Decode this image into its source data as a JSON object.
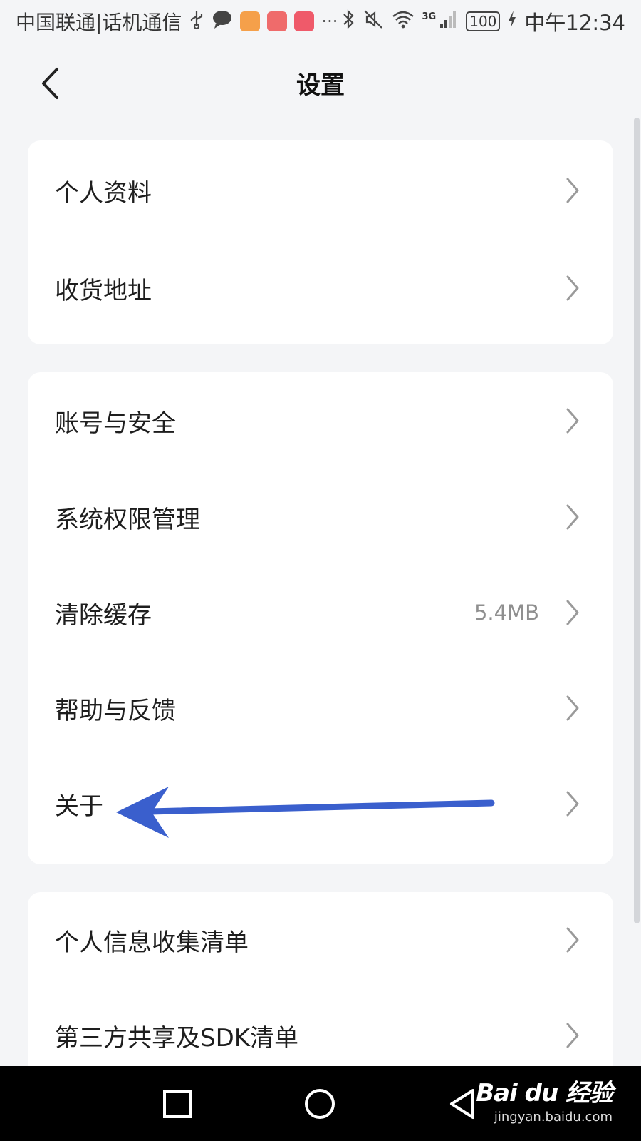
{
  "status_bar": {
    "carrier": "中国联通|话机通信",
    "network": "3G",
    "battery": "100",
    "time": "中午12:34"
  },
  "header": {
    "title": "设置",
    "back_icon": "chevron-left-icon"
  },
  "groups": [
    {
      "items": [
        {
          "label": "个人资料"
        },
        {
          "label": "收货地址"
        }
      ]
    },
    {
      "items": [
        {
          "label": "账号与安全"
        },
        {
          "label": "系统权限管理"
        },
        {
          "label": "清除缓存",
          "value": "5.4MB"
        },
        {
          "label": "帮助与反馈"
        },
        {
          "label": "关于"
        }
      ]
    },
    {
      "items": [
        {
          "label": "个人信息收集清单"
        },
        {
          "label": "第三方共享及SDK清单"
        }
      ]
    }
  ],
  "annotation": {
    "color": "#3a5fcd",
    "points_to": "关于"
  },
  "watermark": {
    "logo": "Bai du 经验",
    "url": "jingyan.baidu.com"
  },
  "colors": {
    "background": "#f4f5f7",
    "card": "#ffffff",
    "chevron": "#9a9a9a"
  }
}
